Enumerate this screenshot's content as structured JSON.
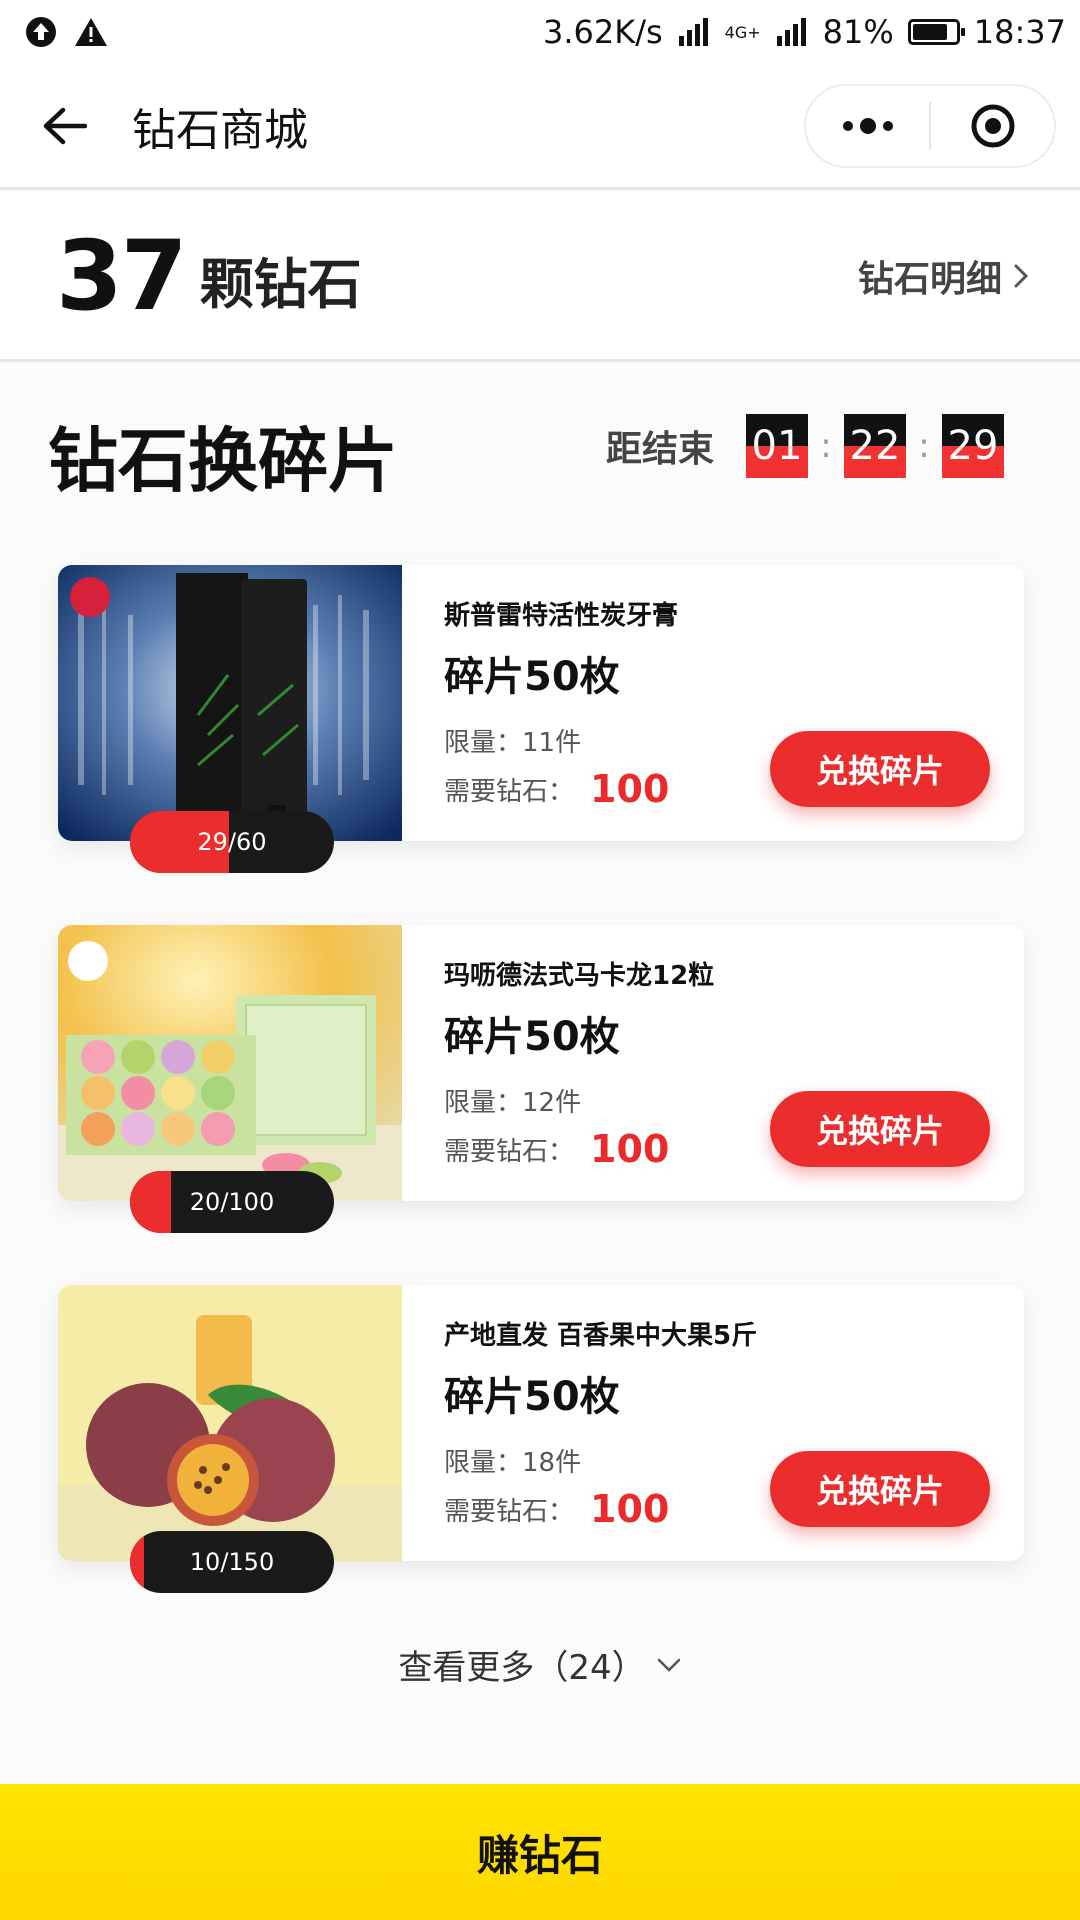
{
  "status_bar": {
    "speed": "3.62K/s",
    "network": "4G+",
    "battery": "81%",
    "battery_level": 0.81,
    "time": "18:37"
  },
  "nav": {
    "title": "钻石商城",
    "back_icon": "arrow-left-icon",
    "more_icon": "more-dots-icon",
    "close_icon": "target-circle-icon"
  },
  "diamonds": {
    "count": "37",
    "unit": "颗钻石",
    "detail_label": "钻石明细"
  },
  "section": {
    "title": "钻石换碎片",
    "countdown_label": "距结束",
    "countdown": [
      "01",
      "22",
      "29"
    ]
  },
  "products": [
    {
      "name": "斯普雷特活性炭牙膏",
      "amount": "碎片50枚",
      "limit": "限量：11件",
      "need_label": "需要钻石：",
      "price": "100",
      "button": "兑换碎片",
      "progress_text": "29/60",
      "progress": 0.483
    },
    {
      "name": "玛呖德法式马卡龙12粒",
      "amount": "碎片50枚",
      "limit": "限量：12件",
      "need_label": "需要钻石：",
      "price": "100",
      "button": "兑换碎片",
      "progress_text": "20/100",
      "progress": 0.2
    },
    {
      "name": "产地直发 百香果中大果5斤",
      "amount": "碎片50枚",
      "limit": "限量：18件",
      "need_label": "需要钻石：",
      "price": "100",
      "button": "兑换碎片",
      "progress_text": "10/150",
      "progress": 0.067
    }
  ],
  "see_more": "查看更多（24）",
  "earn_button": "赚钻石",
  "colors": {
    "accent_red": "#ec2d2d",
    "bottom_yellow": "#ffe400"
  }
}
